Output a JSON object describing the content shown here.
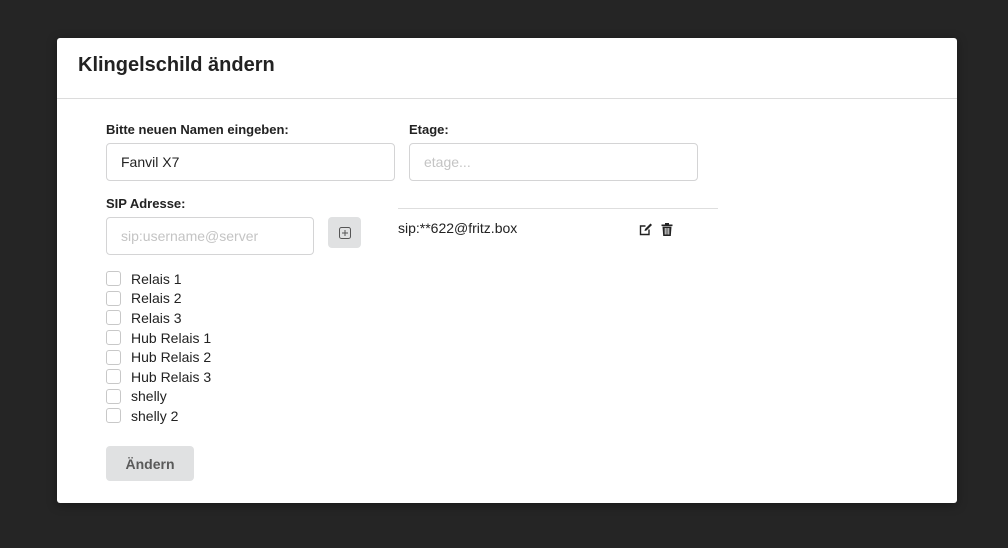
{
  "dialog": {
    "title": "Klingelschild ändern"
  },
  "name_field": {
    "label": "Bitte neuen Namen eingeben:",
    "value": "Fanvil X7",
    "placeholder": ""
  },
  "floor_field": {
    "label": "Etage:",
    "value": "",
    "placeholder": "etage..."
  },
  "sip_field": {
    "label": "SIP Adresse:",
    "value": "",
    "placeholder": "sip:username@server",
    "add_icon": "plus-square-icon"
  },
  "sip_entries": [
    {
      "address": "sip:**622@fritz.box",
      "edit_icon": "edit-icon",
      "delete_icon": "trash-icon"
    }
  ],
  "relays": [
    {
      "label": "Relais 1",
      "checked": false
    },
    {
      "label": "Relais 2",
      "checked": false
    },
    {
      "label": "Relais 3",
      "checked": false
    },
    {
      "label": "Hub Relais 1",
      "checked": false
    },
    {
      "label": "Hub Relais 2",
      "checked": false
    },
    {
      "label": "Hub Relais 3",
      "checked": false
    },
    {
      "label": "shelly",
      "checked": false
    },
    {
      "label": "shelly 2",
      "checked": false
    }
  ],
  "submit": {
    "label": "Ändern"
  },
  "colors": {
    "backdrop": "#252525",
    "button_bg": "#e0e1e2",
    "border": "#d4d4d5"
  }
}
